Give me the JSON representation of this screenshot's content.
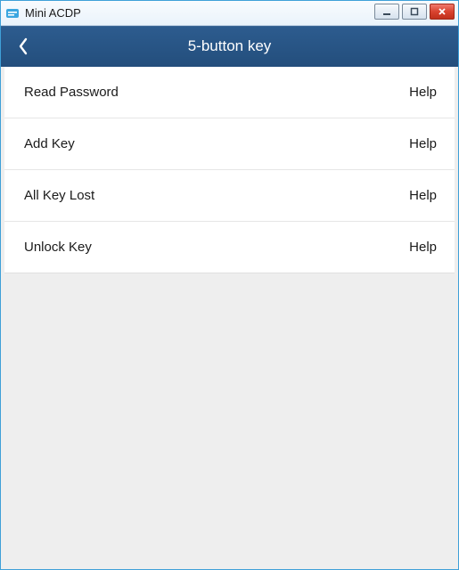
{
  "window": {
    "title": "Mini ACDP"
  },
  "header": {
    "title": "5-button key"
  },
  "menu": {
    "help_label": "Help",
    "items": [
      {
        "label": "Read Password"
      },
      {
        "label": "Add Key"
      },
      {
        "label": "All Key Lost"
      },
      {
        "label": "Unlock Key"
      }
    ]
  }
}
